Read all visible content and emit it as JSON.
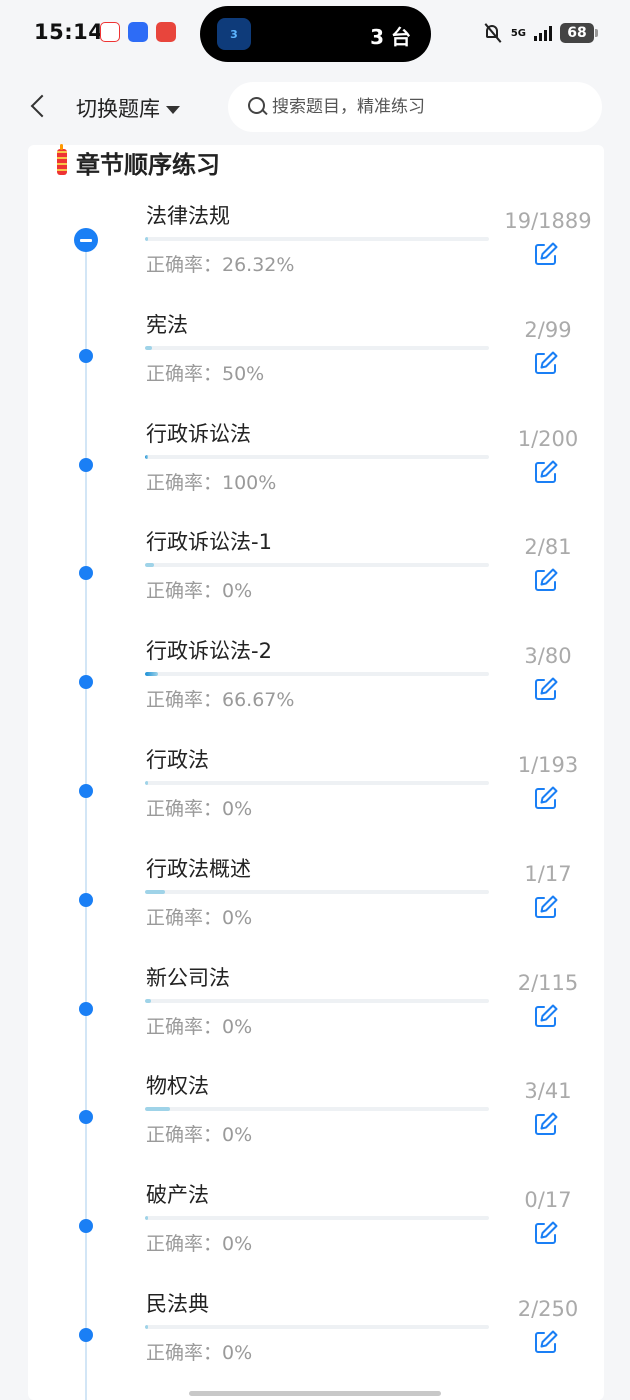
{
  "status_bar": {
    "time": "15:14",
    "island_badge": "3",
    "island_text": "3 台",
    "network": "5G",
    "battery": "68"
  },
  "header": {
    "switch_label": "切换题库",
    "search_placeholder": "搜索题目，精准练习"
  },
  "section": {
    "title": "章节顺序练习"
  },
  "accuracy_prefix": "正确率：",
  "chapters": [
    {
      "name": "法律法规",
      "accuracy": "正确率：26.32%",
      "count": "19/1889",
      "progress": 0.01
    },
    {
      "name": "宪法",
      "accuracy": "正确率：50%",
      "count": "2/99",
      "progress": 0.02
    },
    {
      "name": "行政诉讼法",
      "accuracy": "正确率：100%",
      "count": "1/200",
      "progress": 0.005
    },
    {
      "name": "行政诉讼法-1",
      "accuracy": "正确率：0%",
      "count": "2/81",
      "progress": 0.025
    },
    {
      "name": "行政诉讼法-2",
      "accuracy": "正确率：66.67%",
      "count": "3/80",
      "progress": 0.0375
    },
    {
      "name": "行政法",
      "accuracy": "正确率：0%",
      "count": "1/193",
      "progress": 0.005
    },
    {
      "name": "行政法概述",
      "accuracy": "正确率：0%",
      "count": "1/17",
      "progress": 0.059
    },
    {
      "name": "新公司法",
      "accuracy": "正确率：0%",
      "count": "2/115",
      "progress": 0.017
    },
    {
      "name": "物权法",
      "accuracy": "正确率：0%",
      "count": "3/41",
      "progress": 0.073
    },
    {
      "name": "破产法",
      "accuracy": "正确率：0%",
      "count": "0/17",
      "progress": 0
    },
    {
      "name": "民法典",
      "accuracy": "正确率：0%",
      "count": "2/250",
      "progress": 0.008
    }
  ],
  "colors": {
    "accent": "#1a7ff5",
    "progress_fill": "#9fd3e8",
    "timeline": "#d3e6f6"
  }
}
